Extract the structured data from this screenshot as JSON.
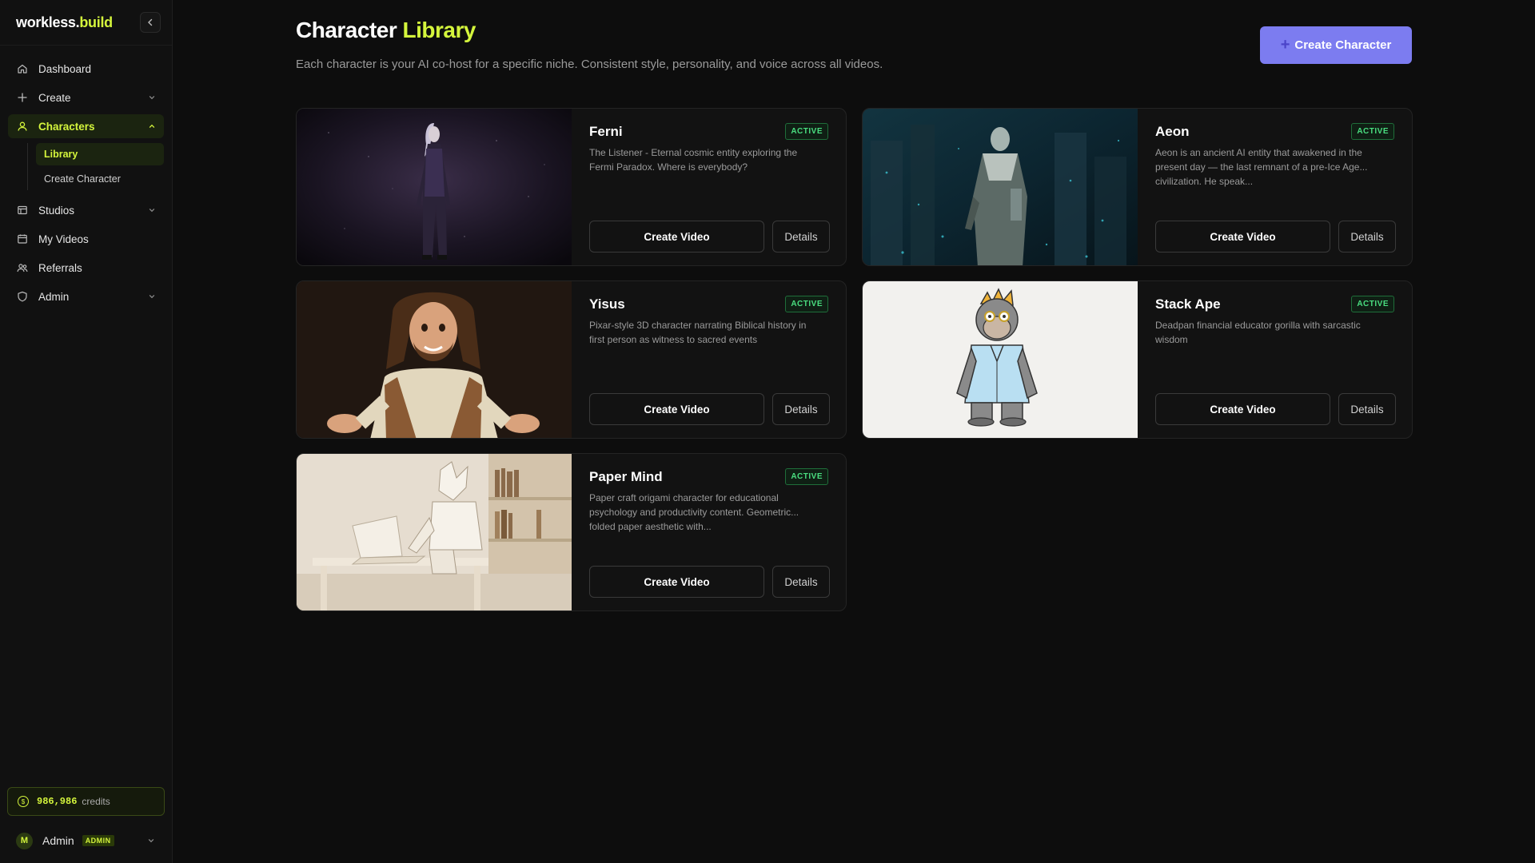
{
  "brand": {
    "part1": "workless",
    "dot": ".",
    "part2": "build"
  },
  "sidebar": {
    "items": [
      {
        "label": "Dashboard",
        "icon": "home-icon"
      },
      {
        "label": "Create",
        "icon": "plus-icon"
      },
      {
        "label": "Characters",
        "icon": "user-icon"
      },
      {
        "label": "Studios",
        "icon": "studio-icon"
      },
      {
        "label": "My Videos",
        "icon": "calendar-icon"
      },
      {
        "label": "Referrals",
        "icon": "users-icon"
      },
      {
        "label": "Admin",
        "icon": "shield-icon"
      }
    ],
    "sub_items": [
      {
        "label": "Library"
      },
      {
        "label": "Create Character"
      }
    ]
  },
  "credits": {
    "amount": "986,986",
    "label": "credits"
  },
  "user": {
    "initial": "M",
    "name": "Admin",
    "role": "ADMIN"
  },
  "page": {
    "title_part1": "Character",
    "title_part2": "Library",
    "subtitle": "Each character is your AI co-host for a specific niche. Consistent style, personality, and voice across all videos.",
    "create_button": "Create Character"
  },
  "buttons": {
    "create_video": "Create Video",
    "details": "Details"
  },
  "characters": [
    {
      "name": "Ferni",
      "status": "ACTIVE",
      "description": "The Listener - Eternal cosmic entity exploring the Fermi Paradox. Where is everybody?"
    },
    {
      "name": "Aeon",
      "status": "ACTIVE",
      "description": "Aeon is an ancient AI entity that awakened in the present day — the last remnant of a pre-Ice Age... civilization. He speak..."
    },
    {
      "name": "Yisus",
      "status": "ACTIVE",
      "description": "Pixar-style 3D character narrating Biblical history in first person as witness to sacred events"
    },
    {
      "name": "Stack Ape",
      "status": "ACTIVE",
      "description": "Deadpan financial educator gorilla with sarcastic wisdom"
    },
    {
      "name": "Paper Mind",
      "status": "ACTIVE",
      "description": "Paper craft origami character for educational psychology and productivity content. Geometric... folded paper aesthetic with..."
    }
  ],
  "colors": {
    "accent": "#d4f53c",
    "primary_button": "#7c7cf0",
    "active_badge": "#4ade80",
    "background": "#0d0d0d"
  }
}
